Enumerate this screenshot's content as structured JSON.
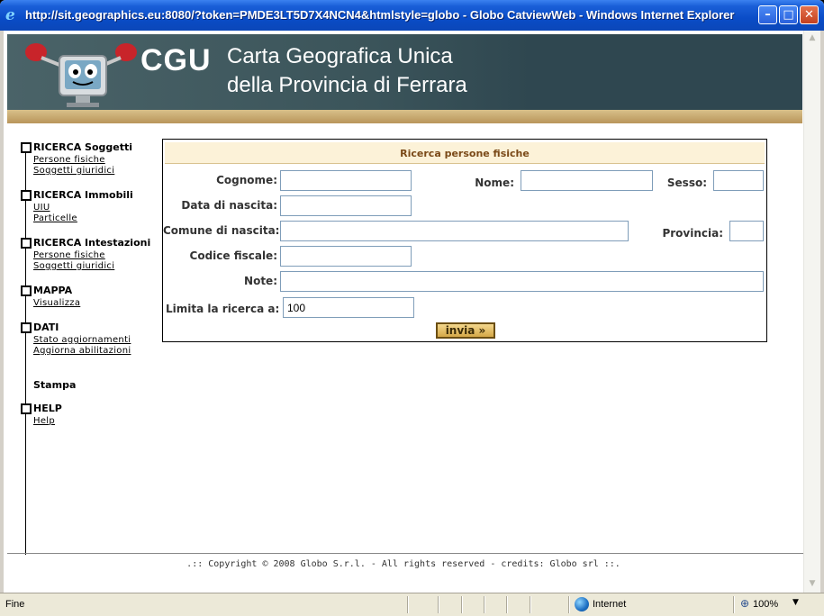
{
  "window": {
    "title": "http://sit.geographics.eu:8080/?token=PMDE3LT5D7X4NCN4&htmlstyle=globo - Globo CatviewWeb - Windows Internet Explorer",
    "minimize_glyph": "–",
    "maximize_glyph": "□",
    "close_glyph": "✕"
  },
  "banner": {
    "logo_text": "CGU",
    "line1": "Carta Geografica Unica",
    "line2": "della Provincia di Ferrara"
  },
  "menu": [
    {
      "title": "RICERCA Soggetti",
      "links": [
        "Persone fisiche",
        "Soggetti giuridici"
      ]
    },
    {
      "title": "RICERCA Immobili",
      "links": [
        "UIU",
        "Particelle"
      ]
    },
    {
      "title": "RICERCA Intestazioni",
      "links": [
        "Persone fisiche",
        "Soggetti giuridici"
      ]
    },
    {
      "title": "MAPPA",
      "links": [
        "Visualizza"
      ]
    },
    {
      "title": "DATI",
      "links": [
        "Stato aggiornamenti",
        "Aggiorna abilitazioni"
      ]
    },
    {
      "title": "Stampa",
      "links": []
    },
    {
      "title": "HELP",
      "links": [
        "Help"
      ]
    }
  ],
  "form": {
    "title": "Ricerca persone fisiche",
    "labels": {
      "cognome": "Cognome:",
      "nome": "Nome:",
      "sesso": "Sesso:",
      "data_nascita": "Data di nascita:",
      "comune_nascita": "Comune di nascita:",
      "provincia": "Provincia:",
      "codice_fiscale": "Codice fiscale:",
      "note": "Note:",
      "limita": "Limita la ricerca a:"
    },
    "values": {
      "cognome": "",
      "nome": "",
      "sesso": "",
      "data_nascita": "",
      "comune_nascita": "",
      "provincia": "",
      "codice_fiscale": "",
      "note": "",
      "limita": "100"
    },
    "submit_label": "invia »"
  },
  "footer": ".:: Copyright © 2008 Globo S.r.l. - All rights reserved - credits: Globo srl ::.",
  "statusbar": {
    "status": "Fine",
    "zone": "Internet",
    "zoom": "100%"
  },
  "colors": {
    "banner_bg": "#2f4750",
    "gold_bar": "#c9a86a",
    "panel_header_bg": "#fcf2d8",
    "panel_title": "#7a4a18",
    "titlebar": "#0a4cc7"
  },
  "icons": [
    "ie-icon",
    "mascot-icon",
    "globe-icon",
    "zoom-icon",
    "scroll-up-icon",
    "scroll-down-icon"
  ]
}
